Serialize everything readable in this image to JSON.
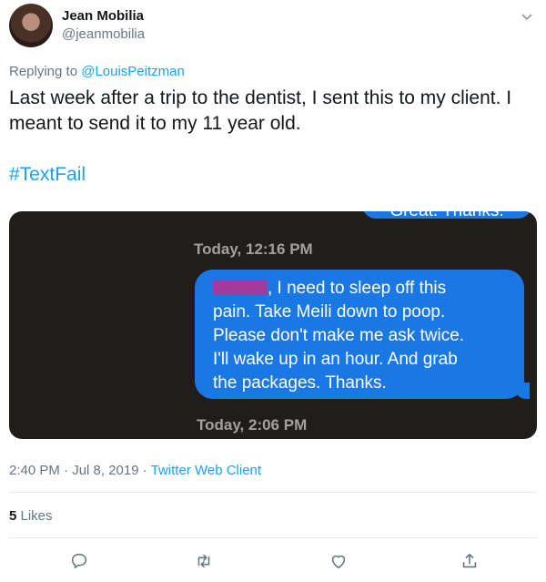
{
  "author": {
    "name": "Jean Mobilia",
    "handle": "@jeanmobilia"
  },
  "reply": {
    "prefix": "Replying to ",
    "to": "@LouisPeitzman"
  },
  "tweet": {
    "text": "Last week after a trip to the dentist, I sent this to my client. I meant to send it to my 11 year old.",
    "hashtag": "#TextFail"
  },
  "screenshot": {
    "cut_bubble_text": "Great. Thanks.",
    "timestamp_top": "Today, 12:16 PM",
    "message_lines": [
      ", I need to sleep off this",
      "pain.  Take Meili down to poop.",
      "Please don't make me ask twice.",
      "I'll wake up in an hour.  And grab",
      "the packages.  Thanks."
    ],
    "timestamp_bottom": "Today, 2:06 PM"
  },
  "meta": {
    "time_date": "2:40 PM · Jul 8, 2019 · ",
    "client": "Twitter Web Client"
  },
  "likes": {
    "count": "5",
    "label": " Likes"
  },
  "colors": {
    "link": "#1da1f2",
    "imessage_blue": "#1a78e5",
    "redaction": "#a33a9e"
  },
  "actions": [
    "reply-icon",
    "retweet-icon",
    "like-icon",
    "share-icon"
  ]
}
